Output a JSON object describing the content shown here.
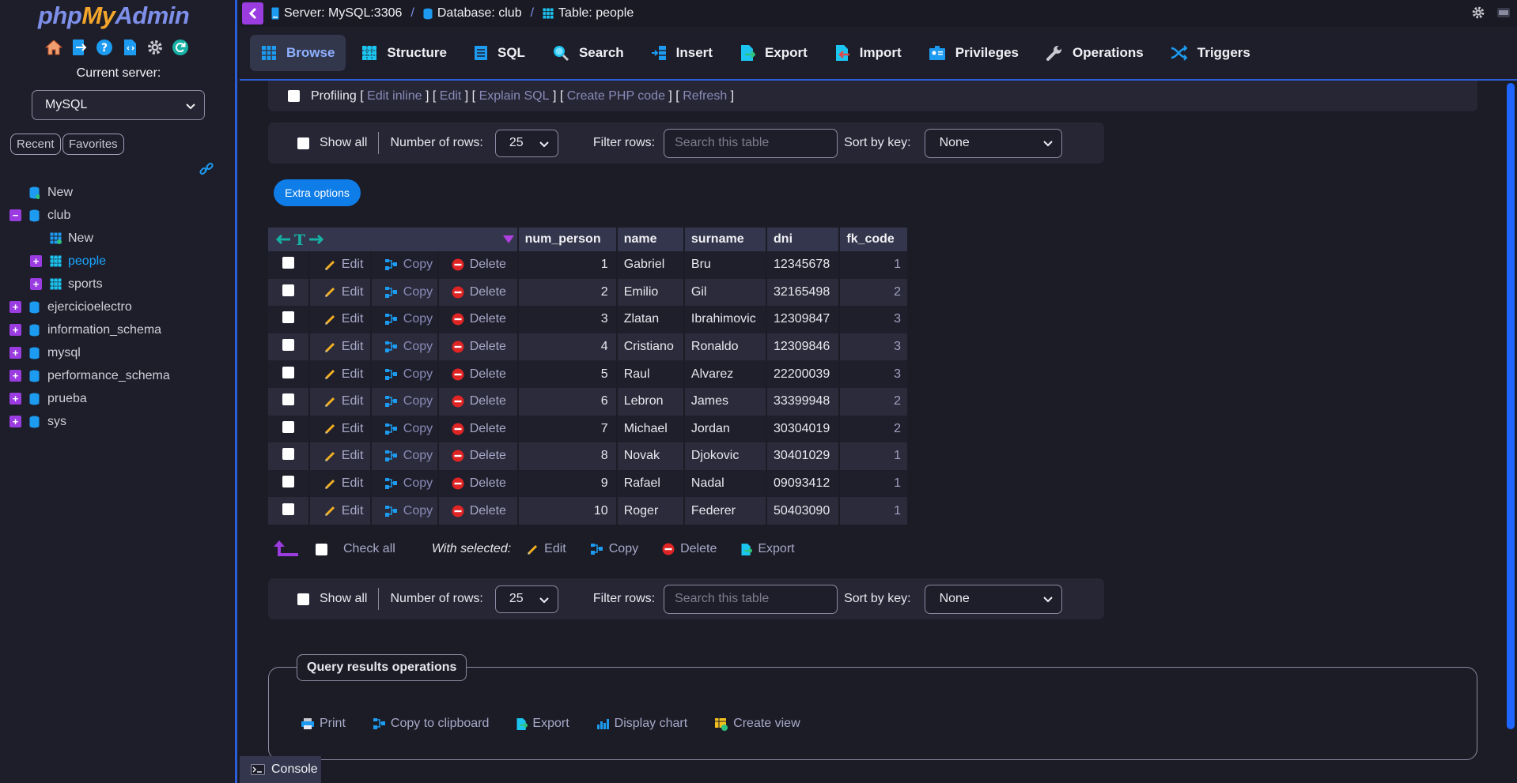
{
  "sidebar": {
    "logo": {
      "php": "php",
      "my": "My",
      "admin": "Admin"
    },
    "quick_icons": [
      "home-icon",
      "logout-icon",
      "help-icon",
      "docs-icon",
      "settings-icon",
      "reload-icon"
    ],
    "current_server_label": "Current server:",
    "server_select": "MySQL",
    "recent": "Recent",
    "favorites": "Favorites",
    "tree": [
      {
        "label": "New",
        "level": 0,
        "kind": "new"
      },
      {
        "label": "club",
        "level": 0,
        "kind": "db",
        "expanded": true
      },
      {
        "label": "New",
        "level": 1,
        "kind": "new-table"
      },
      {
        "label": "people",
        "level": 1,
        "kind": "table",
        "active": true
      },
      {
        "label": "sports",
        "level": 1,
        "kind": "table"
      },
      {
        "label": "ejercicioelectro",
        "level": 0,
        "kind": "db"
      },
      {
        "label": "information_schema",
        "level": 0,
        "kind": "db"
      },
      {
        "label": "mysql",
        "level": 0,
        "kind": "db"
      },
      {
        "label": "performance_schema",
        "level": 0,
        "kind": "db"
      },
      {
        "label": "prueba",
        "level": 0,
        "kind": "db"
      },
      {
        "label": "sys",
        "level": 0,
        "kind": "db"
      }
    ]
  },
  "breadcrumb": {
    "server": "Server: MySQL:3306",
    "database": "Database: club",
    "table": "Table: people",
    "separator": "/"
  },
  "tabs": [
    {
      "label": "Browse",
      "icon": "browse-icon",
      "active": true
    },
    {
      "label": "Structure",
      "icon": "structure-icon"
    },
    {
      "label": "SQL",
      "icon": "sql-icon"
    },
    {
      "label": "Search",
      "icon": "search-icon"
    },
    {
      "label": "Insert",
      "icon": "insert-icon"
    },
    {
      "label": "Export",
      "icon": "export-icon"
    },
    {
      "label": "Import",
      "icon": "import-icon"
    },
    {
      "label": "Privileges",
      "icon": "privileges-icon"
    },
    {
      "label": "Operations",
      "icon": "operations-icon"
    },
    {
      "label": "Triggers",
      "icon": "triggers-icon"
    }
  ],
  "profiling": {
    "label": "Profiling",
    "links": [
      "Edit inline",
      "Edit",
      "Explain SQL",
      "Create PHP code",
      "Refresh"
    ]
  },
  "navigation": {
    "show_all": "Show all",
    "number_of_rows_label": "Number of rows:",
    "number_of_rows": "25",
    "filter_rows_label": "Filter rows:",
    "filter_placeholder": "Search this table",
    "sort_by_key_label": "Sort by key:",
    "sort_by_key": "None"
  },
  "extra_options": "Extra options",
  "table": {
    "columns": [
      "num_person",
      "name",
      "surname",
      "dni",
      "fk_code"
    ],
    "actions": {
      "edit": "Edit",
      "copy": "Copy",
      "delete": "Delete"
    },
    "rows": [
      [
        "1",
        "Gabriel",
        "Bru",
        "12345678",
        "1"
      ],
      [
        "2",
        "Emilio",
        "Gil",
        "32165498",
        "2"
      ],
      [
        "3",
        "Zlatan",
        "Ibrahimovic",
        "12309847",
        "3"
      ],
      [
        "4",
        "Cristiano",
        "Ronaldo",
        "12309846",
        "3"
      ],
      [
        "5",
        "Raul",
        "Alvarez",
        "22200039",
        "3"
      ],
      [
        "6",
        "Lebron",
        "James",
        "33399948",
        "2"
      ],
      [
        "7",
        "Michael",
        "Jordan",
        "30304019",
        "2"
      ],
      [
        "8",
        "Novak",
        "Djokovic",
        "30401029",
        "1"
      ],
      [
        "9",
        "Rafael",
        "Nadal",
        "09093412",
        "1"
      ],
      [
        "10",
        "Roger",
        "Federer",
        "50403090",
        "1"
      ]
    ]
  },
  "with_selected": {
    "check_all": "Check all",
    "label": "With selected:",
    "edit": "Edit",
    "copy": "Copy",
    "delete": "Delete",
    "export": "Export"
  },
  "query_results_operations": {
    "title": "Query results operations",
    "items": [
      "Print",
      "Copy to clipboard",
      "Export",
      "Display chart",
      "Create view"
    ]
  },
  "console": "Console",
  "colors": {
    "accent": "#9a3ce0",
    "link_blue": "#1aa7ff",
    "button_blue": "#0f7de8",
    "active_tab": "#8fb0ff"
  }
}
